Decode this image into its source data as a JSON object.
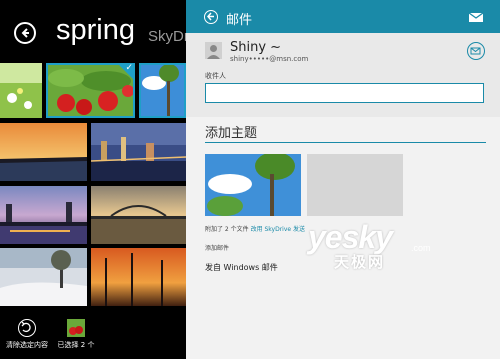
{
  "photos_app": {
    "folder_title": "spring",
    "next_folder": "SkyDrive",
    "appbar": {
      "clear_selection": "清除选定内容",
      "selected_count": "已选择 2 个"
    }
  },
  "mail": {
    "header_title": "邮件",
    "from_name": "Shiny ~",
    "from_email": "shiny•••••@msn.com",
    "to_label": "收件人",
    "to_value": "",
    "subject_placeholder": "添加主题",
    "attachment_text": "附加了 2 个文件",
    "attachment_link": "改用 SkyDrive 发送",
    "add_mail_label": "添加邮件",
    "signature": "发自 Windows 邮件",
    "accent_color": "#1a8aa8"
  },
  "watermark": {
    "brand": "yesky",
    "tld": ".com",
    "name_cn": "天极网"
  }
}
